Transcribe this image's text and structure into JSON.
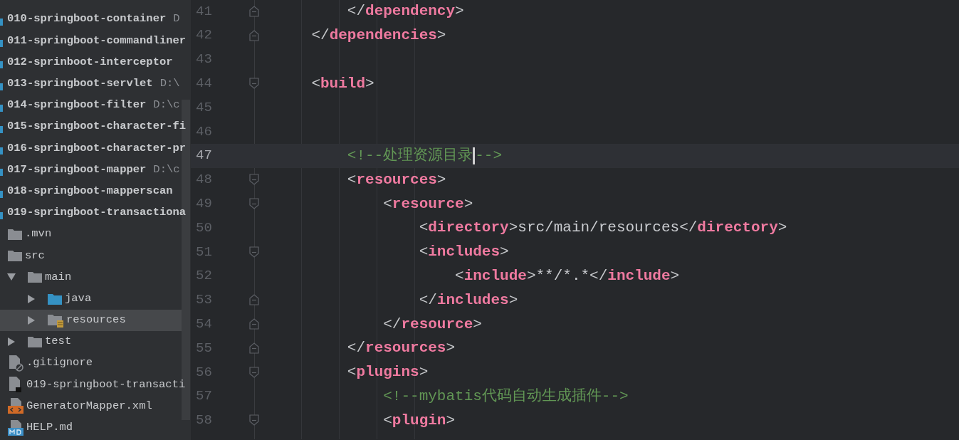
{
  "project_tree": {
    "items": [
      {
        "kind": "project",
        "name": "010-springboot-container",
        "path": "D"
      },
      {
        "kind": "project",
        "name": "011-springboot-commandliner"
      },
      {
        "kind": "project",
        "name": "012-sprinboot-interceptor"
      },
      {
        "kind": "project",
        "name": "013-springboot-servlet",
        "path": "D:\\"
      },
      {
        "kind": "project",
        "name": "014-springboot-filter",
        "path": "D:\\c"
      },
      {
        "kind": "project",
        "name": "015-springboot-character-fi"
      },
      {
        "kind": "project",
        "name": "016-springboot-character-pr"
      },
      {
        "kind": "project",
        "name": "017-springboot-mapper",
        "path": "D:\\c"
      },
      {
        "kind": "project",
        "name": "018-springboot-mapperscan"
      },
      {
        "kind": "project",
        "name": "019-springboot-transactiona"
      },
      {
        "kind": "folder",
        "name": ".mvn",
        "selected": false
      },
      {
        "kind": "folder",
        "name": "src",
        "selected": false,
        "children": [
          {
            "kind": "folder",
            "name": "main",
            "expanded": true,
            "selected": false,
            "children": [
              {
                "kind": "source-folder",
                "name": "java",
                "expanded": false,
                "selected": false
              },
              {
                "kind": "resource-folder",
                "name": "resources",
                "expanded": false,
                "selected": true
              }
            ]
          },
          {
            "kind": "folder",
            "name": "test",
            "expanded": false,
            "selected": false
          }
        ]
      },
      {
        "kind": "ignore-file",
        "name": ".gitignore",
        "selected": false
      },
      {
        "kind": "module-file",
        "name": "019-springboot-transacti",
        "selected": false
      },
      {
        "kind": "xml-file",
        "name": "GeneratorMapper.xml",
        "selected": false
      },
      {
        "kind": "md-file",
        "name": "HELP.md",
        "selected": false
      }
    ]
  },
  "editor": {
    "lines": [
      {
        "number": "41",
        "kind": "fold-end",
        "current": false,
        "tokens": [
          {
            "kind": "bracket",
            "text": "        </"
          },
          {
            "kind": "tag",
            "text": "dependency"
          },
          {
            "kind": "bracket",
            "text": ">"
          }
        ]
      },
      {
        "number": "42",
        "kind": "fold-end",
        "current": false,
        "tokens": [
          {
            "kind": "bracket",
            "text": "    </"
          },
          {
            "kind": "tag",
            "text": "dependencies"
          },
          {
            "kind": "bracket",
            "text": ">"
          }
        ]
      },
      {
        "number": "43",
        "kind": "plain",
        "current": false
      },
      {
        "number": "44",
        "kind": "fold-start",
        "current": false,
        "tokens": [
          {
            "kind": "bracket",
            "text": "    <"
          },
          {
            "kind": "tag",
            "text": "build"
          },
          {
            "kind": "bracket",
            "text": ">"
          }
        ]
      },
      {
        "number": "45",
        "kind": "plain",
        "current": false
      },
      {
        "number": "46",
        "kind": "plain",
        "current": false
      },
      {
        "number": "47",
        "kind": "plain",
        "current": true,
        "tokens": [
          {
            "kind": "comment",
            "text": "        <!--处理资源目录"
          },
          {
            "kind": "caret"
          },
          {
            "kind": "comment",
            "text": "-->"
          }
        ]
      },
      {
        "number": "48",
        "kind": "fold-start",
        "current": false,
        "tokens": [
          {
            "kind": "bracket",
            "text": "        <"
          },
          {
            "kind": "tag",
            "text": "resources"
          },
          {
            "kind": "bracket",
            "text": ">"
          }
        ]
      },
      {
        "number": "49",
        "kind": "fold-start",
        "current": false,
        "tokens": [
          {
            "kind": "bracket",
            "text": "            <"
          },
          {
            "kind": "tag",
            "text": "resource"
          },
          {
            "kind": "bracket",
            "text": ">"
          }
        ]
      },
      {
        "number": "50",
        "kind": "plain",
        "current": false,
        "tokens": [
          {
            "kind": "bracket",
            "text": "                <"
          },
          {
            "kind": "tag",
            "text": "directory"
          },
          {
            "kind": "bracket",
            "text": ">"
          },
          {
            "kind": "text",
            "text": "src/main/resources"
          },
          {
            "kind": "bracket",
            "text": "</"
          },
          {
            "kind": "tag",
            "text": "directory"
          },
          {
            "kind": "bracket",
            "text": ">"
          }
        ]
      },
      {
        "number": "51",
        "kind": "fold-start",
        "current": false,
        "tokens": [
          {
            "kind": "bracket",
            "text": "                <"
          },
          {
            "kind": "tag",
            "text": "includes"
          },
          {
            "kind": "bracket",
            "text": ">"
          }
        ]
      },
      {
        "number": "52",
        "kind": "plain",
        "current": false,
        "tokens": [
          {
            "kind": "bracket",
            "text": "                    <"
          },
          {
            "kind": "tag",
            "text": "include"
          },
          {
            "kind": "bracket",
            "text": ">"
          },
          {
            "kind": "text",
            "text": "**/*.*"
          },
          {
            "kind": "bracket",
            "text": "</"
          },
          {
            "kind": "tag",
            "text": "include"
          },
          {
            "kind": "bracket",
            "text": ">"
          }
        ]
      },
      {
        "number": "53",
        "kind": "fold-end",
        "current": false,
        "tokens": [
          {
            "kind": "bracket",
            "text": "                </"
          },
          {
            "kind": "tag",
            "text": "includes"
          },
          {
            "kind": "bracket",
            "text": ">"
          }
        ]
      },
      {
        "number": "54",
        "kind": "fold-end",
        "current": false,
        "tokens": [
          {
            "kind": "bracket",
            "text": "            </"
          },
          {
            "kind": "tag",
            "text": "resource"
          },
          {
            "kind": "bracket",
            "text": ">"
          }
        ]
      },
      {
        "number": "55",
        "kind": "fold-end",
        "current": false,
        "tokens": [
          {
            "kind": "bracket",
            "text": "        </"
          },
          {
            "kind": "tag",
            "text": "resources"
          },
          {
            "kind": "bracket",
            "text": ">"
          }
        ]
      },
      {
        "number": "56",
        "kind": "fold-start",
        "current": false,
        "tokens": [
          {
            "kind": "bracket",
            "text": "        <"
          },
          {
            "kind": "tag",
            "text": "plugins"
          },
          {
            "kind": "bracket",
            "text": ">"
          }
        ]
      },
      {
        "number": "57",
        "kind": "plain",
        "current": false,
        "tokens": [
          {
            "kind": "comment",
            "text": "            <!--mybatis代码自动生成插件-->"
          }
        ]
      },
      {
        "number": "58",
        "kind": "fold-start",
        "current": false,
        "tokens": [
          {
            "kind": "bracket",
            "text": "            <"
          },
          {
            "kind": "tag",
            "text": "plugin"
          },
          {
            "kind": "bracket",
            "text": ">"
          }
        ]
      }
    ]
  }
}
